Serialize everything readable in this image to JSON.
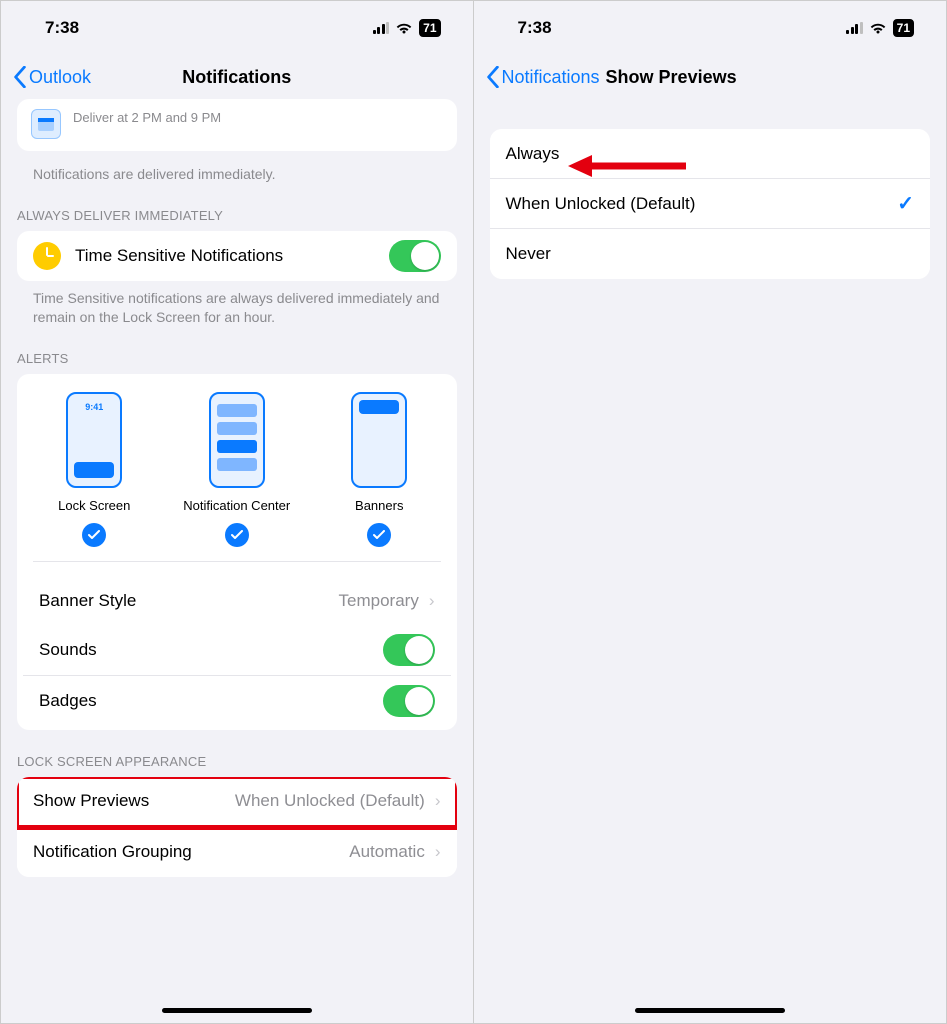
{
  "status": {
    "time": "7:38",
    "battery": "71"
  },
  "left": {
    "back": "Outlook",
    "title": "Notifications",
    "schedule_sub": "Deliver at 2 PM and 9 PM",
    "delivered_text": "Notifications are delivered immediately.",
    "sec_always": "Always Deliver Immediately",
    "time_sensitive": "Time Sensitive Notifications",
    "time_sensitive_footer": "Time Sensitive notifications are always delivered immediately and remain on the Lock Screen for an hour.",
    "sec_alerts": "Alerts",
    "alerts": {
      "lock": "Lock Screen",
      "nc": "Notification Center",
      "banners": "Banners"
    },
    "banner_style": {
      "label": "Banner Style",
      "value": "Temporary"
    },
    "sounds": "Sounds",
    "badges": "Badges",
    "sec_lock": "Lock Screen Appearance",
    "show_previews": {
      "label": "Show Previews",
      "value": "When Unlocked (Default)"
    },
    "grouping": {
      "label": "Notification Grouping",
      "value": "Automatic"
    }
  },
  "right": {
    "back": "Notifications",
    "title": "Show Previews",
    "options": {
      "always": "Always",
      "unlocked": "When Unlocked (Default)",
      "never": "Never"
    }
  }
}
